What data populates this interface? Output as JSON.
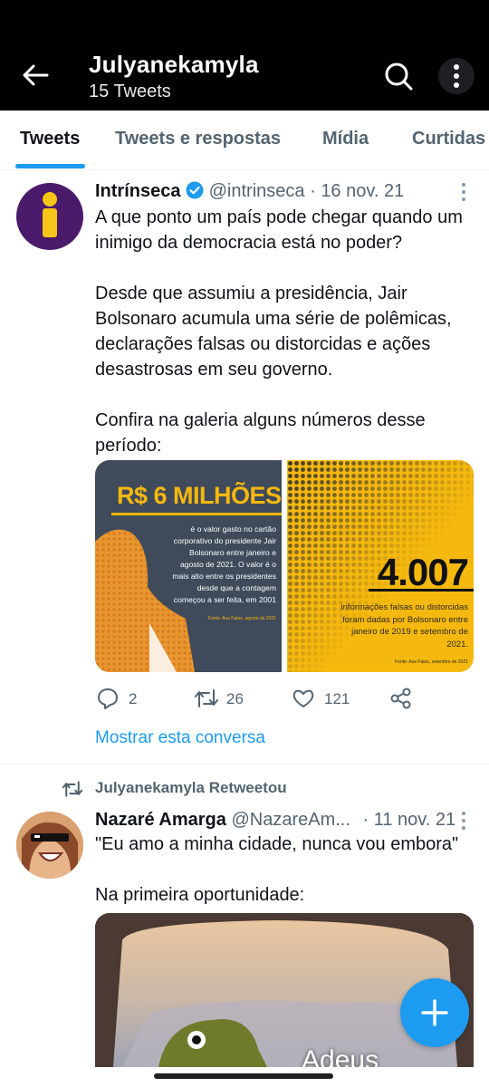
{
  "header": {
    "title": "Julyanekamyla",
    "subtitle": "15 Tweets",
    "back_icon": "arrow-left-icon",
    "search_icon": "search-icon",
    "more_icon": "more-vertical-icon"
  },
  "tabs": [
    {
      "label": "Tweets",
      "active": true
    },
    {
      "label": "Tweets e respostas",
      "active": false
    },
    {
      "label": "Mídia",
      "active": false
    },
    {
      "label": "Curtidas",
      "active": false
    }
  ],
  "tweet1": {
    "author": "Intrínseca",
    "verified": true,
    "handle": "@intrinseca",
    "dot": "·",
    "date": "16 nov. 21",
    "text": "A que ponto um país pode chegar quando um inimigo da democracia está no poder?\n\nDesde que assumiu a presidência, Jair Bolsonaro acumula uma série de polêmicas, declarações falsas ou distorcidas e ações desastrosas em seu governo.\n\nConfira na galeria alguns números desse período:",
    "media_left": {
      "headline": "R$ 6 MILHÕES",
      "body": "é o valor gasto no cartão corporativo do presidente Jair Bolsonaro entre janeiro e agosto de 2021. O valor é o mais alto entre os presidentes desde que a contagem começou a ser feita, em 2001",
      "source": "Fonte: Aos Fatos, agosto de 2021"
    },
    "media_right": {
      "headline": "4.007",
      "body": "informações falsas ou distorcidas foram dadas por Bolsonaro entre janeiro de 2019 e setembro de 2021.",
      "source": "Fonte: Aos Fatos, setembro de 2021"
    },
    "replies": "2",
    "retweets": "26",
    "likes": "121",
    "show_conversation": "Mostrar esta conversa"
  },
  "retweet_label": "Julyanekamyla Retweetou",
  "tweet2": {
    "author": "Nazaré Amarga",
    "handle": "@NazareAm...",
    "dot": "·",
    "date": "11 nov. 21",
    "text": "\"Eu amo a minha cidade, nunca vou embora\"\n\nNa primeira oportunidade:",
    "media_caption": "Adeus"
  },
  "colors": {
    "accent": "#1d9bf0",
    "brand_purple": "#4a1a6b",
    "yellow": "#f5b80e",
    "dark_slate": "#3f4a5a"
  }
}
